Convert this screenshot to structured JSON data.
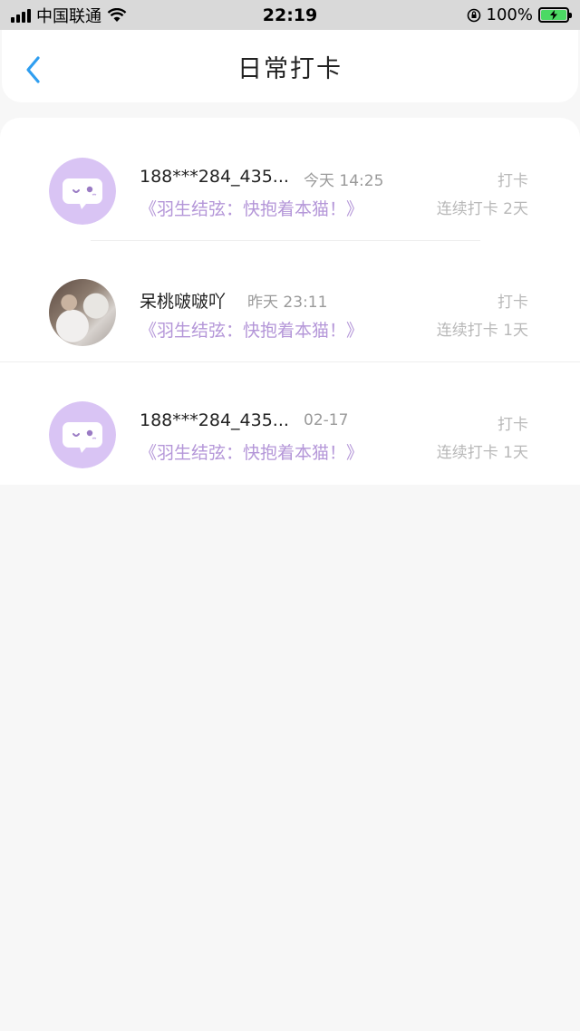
{
  "status_bar": {
    "carrier": "中国联通",
    "time": "22:19",
    "battery_percent": "100%"
  },
  "header": {
    "title": "日常打卡",
    "back_icon": "chevron-left-icon",
    "accent_color": "#2f9ef0"
  },
  "list": [
    {
      "name": "188***284_435...",
      "time": "今天 14:25",
      "book": "《羽生结弦：快抱着本猫！》",
      "action": "打卡",
      "streak": "连续打卡 2天",
      "avatar": "chat-bubble-avatar"
    },
    {
      "name": "呆桃啵啵吖",
      "time": "昨天 23:11",
      "book": "《羽生结弦：快抱着本猫！》",
      "action": "打卡",
      "streak": "连续打卡 1天",
      "avatar": "photo-avatar"
    },
    {
      "name": "188***284_435...",
      "time": "02-17",
      "book": "《羽生结弦：快抱着本猫！》",
      "action": "打卡",
      "streak": "连续打卡 1天",
      "avatar": "chat-bubble-avatar"
    }
  ],
  "colors": {
    "book_title": "#b496d8",
    "avatar_bg": "#d9c4f4"
  }
}
